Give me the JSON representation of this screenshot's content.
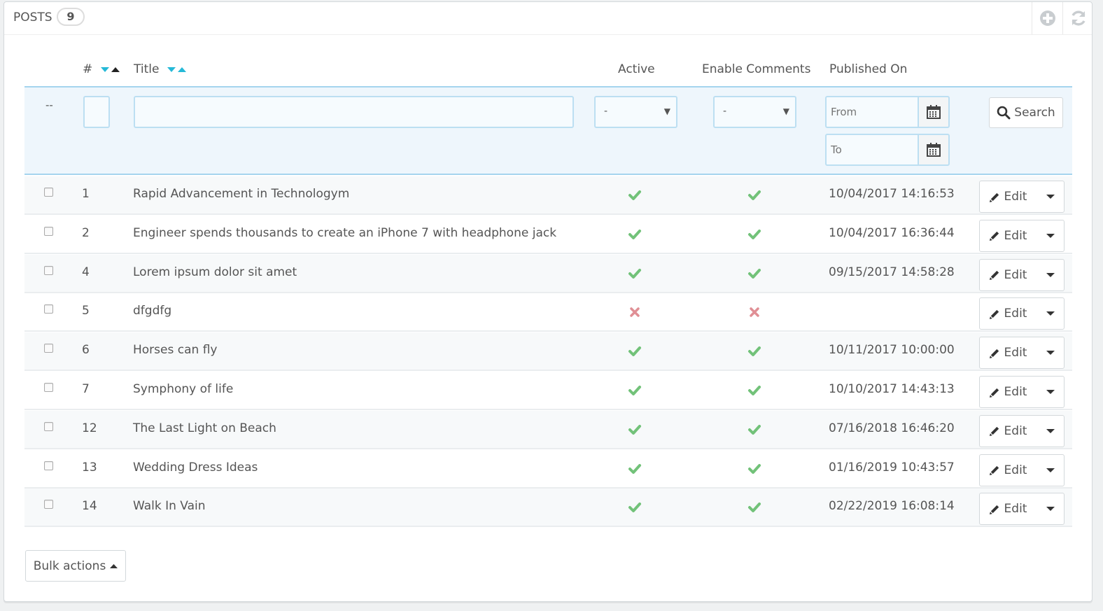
{
  "header": {
    "title": "POSTS",
    "count": "9",
    "add_icon": "plus-circle-icon",
    "refresh_icon": "refresh-icon"
  },
  "columns": {
    "id": "#",
    "title": "Title",
    "active": "Active",
    "enable_comments": "Enable Comments",
    "published_on": "Published On"
  },
  "filters": {
    "dash": "--",
    "id_value": "",
    "title_value": "",
    "active_selected": "-",
    "comments_selected": "-",
    "from_placeholder": "From",
    "to_placeholder": "To",
    "search_label": "Search"
  },
  "rows": [
    {
      "id": "1",
      "title": "Rapid Advancement in Technologym",
      "active": true,
      "comments": true,
      "published": "10/04/2017 14:16:53"
    },
    {
      "id": "2",
      "title": "Engineer spends thousands to create an iPhone 7 with headphone jack",
      "active": true,
      "comments": true,
      "published": "10/04/2017 16:36:44"
    },
    {
      "id": "4",
      "title": "Lorem ipsum dolor sit amet",
      "active": true,
      "comments": true,
      "published": "09/15/2017 14:58:28"
    },
    {
      "id": "5",
      "title": "dfgdfg",
      "active": false,
      "comments": false,
      "published": ""
    },
    {
      "id": "6",
      "title": "Horses can fly",
      "active": true,
      "comments": true,
      "published": "10/11/2017 10:00:00"
    },
    {
      "id": "7",
      "title": "Symphony of life",
      "active": true,
      "comments": true,
      "published": "10/10/2017 14:43:13"
    },
    {
      "id": "12",
      "title": "The Last Light on Beach",
      "active": true,
      "comments": true,
      "published": "07/16/2018 16:46:20"
    },
    {
      "id": "13",
      "title": "Wedding Dress Ideas",
      "active": true,
      "comments": true,
      "published": "01/16/2019 10:43:57"
    },
    {
      "id": "14",
      "title": "Walk In Vain",
      "active": true,
      "comments": true,
      "published": "02/22/2019 16:08:14"
    }
  ],
  "row_actions": {
    "edit_label": "Edit"
  },
  "footer": {
    "bulk_actions_label": "Bulk actions"
  },
  "colors": {
    "check": "#72c279",
    "cross": "#e08f95",
    "sort_active": "#25b9d7",
    "filter_bg": "#eef6fc",
    "filter_border": "#a5d4ee"
  }
}
